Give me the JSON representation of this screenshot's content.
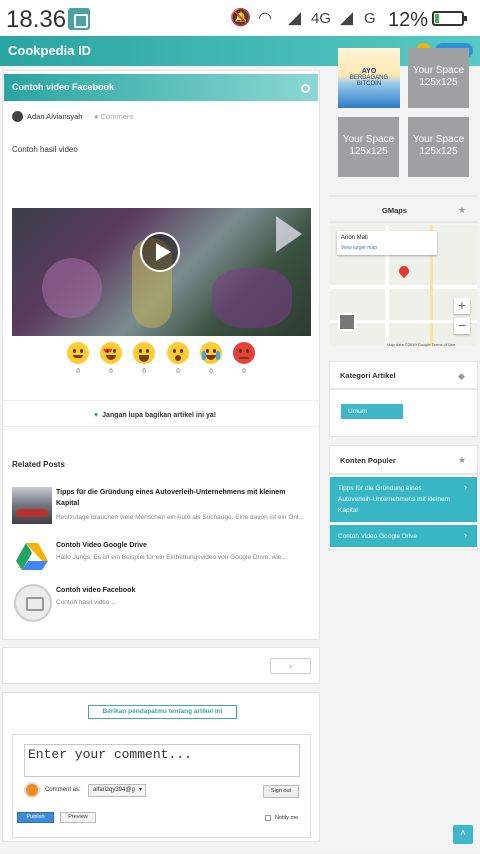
{
  "status_bar": {
    "time": "18.36",
    "network_4g": "4G",
    "network_g": "G",
    "battery": "12%",
    "battery_level": 0.12
  },
  "header": {
    "logo": "Cookpedia ID",
    "bell_icon": "bell-icon",
    "search_icon": "search-icon"
  },
  "post": {
    "title": "Contoh video Facebook",
    "author": "Adan Alviansyah",
    "comment_label": "Comment",
    "body": "Contoh hasil video"
  },
  "reactions": [
    {
      "name": "smile",
      "count": "0"
    },
    {
      "name": "love",
      "count": "0"
    },
    {
      "name": "laugh",
      "count": "0"
    },
    {
      "name": "wow",
      "count": "0"
    },
    {
      "name": "cry",
      "count": "0"
    },
    {
      "name": "angry",
      "count": "0"
    }
  ],
  "share_text": "Jangan lupa bagikan artikel ini ya!",
  "related": {
    "heading": "Related Posts",
    "items": [
      {
        "title": "Tipps für die Gründung eines Autoverleih-Unternehmens mit kleinem Kapital",
        "desc": "Heutzutage brauchen viele Menschen ein Auto als Suchauge. Eine davon ist ein Onl..."
      },
      {
        "title": "Contoh Video Google Drive",
        "desc": "Hallo Jungs, Es ist ein Beispiel für ein Einbettungsvideo von Google Drive. wie..."
      },
      {
        "title": "Contoh video Facebook",
        "desc": "Contoh hasil video ..."
      }
    ]
  },
  "comments": {
    "invite": "Berikan pendapatmu tentang artikel ini",
    "placeholder": "Enter your comment...",
    "comment_as": "Comment as:",
    "account": "alfarizqy394@g",
    "sign_out": "Sign out",
    "publish": "Publish",
    "preview": "Preview",
    "notify": "Notify me"
  },
  "sidebar": {
    "ads": {
      "bitcoin_line1": "AYO",
      "bitcoin_line2": "BERDAGANG BITCOIN",
      "slot": "Your Space 125x125"
    },
    "gmaps": {
      "heading": "GMaps",
      "place": "Arion Mall",
      "link": "View larger map",
      "footer": "Map data ©2019 Google  Terms of Use"
    },
    "kategori": {
      "heading": "Kategori Artikel",
      "tag": "Umum"
    },
    "populer": {
      "heading": "Konten Populer",
      "items": [
        "Tipps für die Gründung eines Autoverleih-Unternehmens mit kleinem Kapital",
        "Contoh Video Google Drive"
      ]
    }
  }
}
